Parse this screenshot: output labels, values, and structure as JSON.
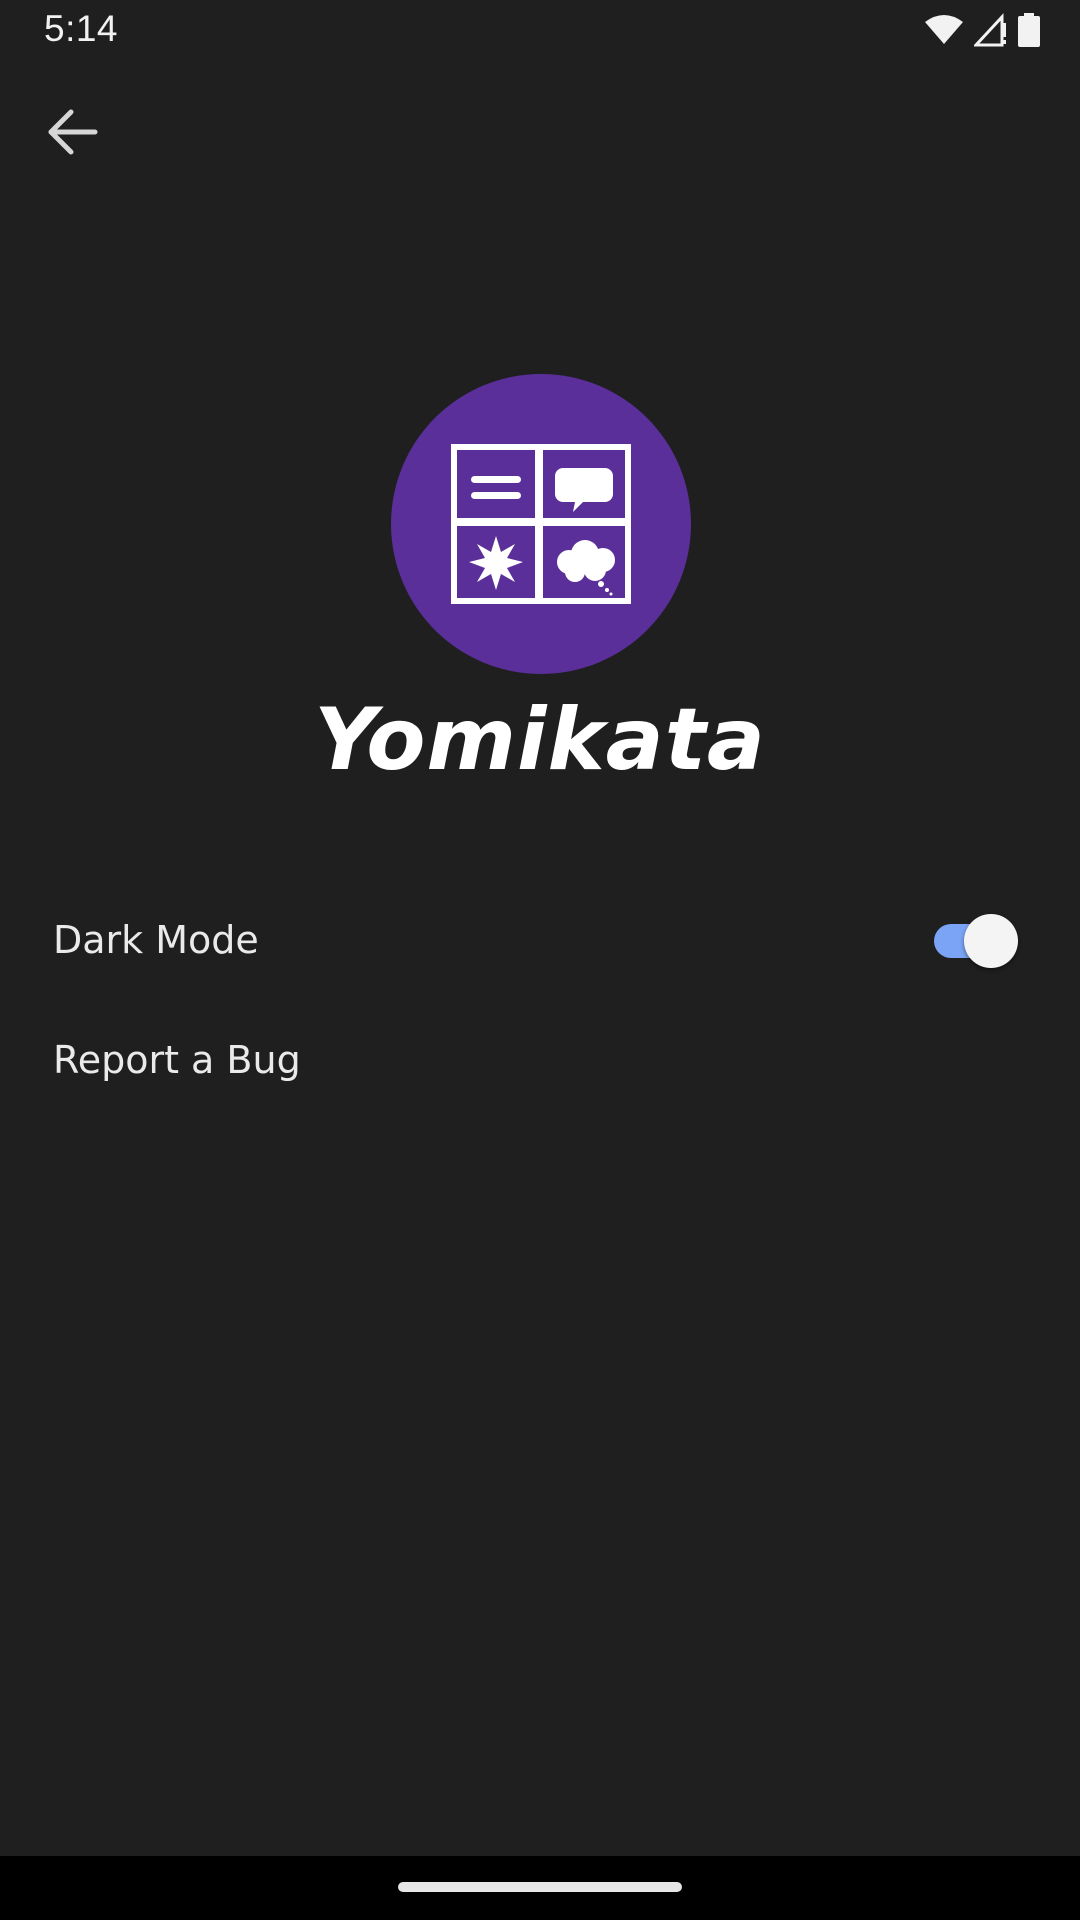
{
  "status_bar": {
    "time": "5:14",
    "icons": [
      "wifi-icon",
      "cell-signal-icon",
      "battery-icon"
    ]
  },
  "header": {
    "back_icon": "arrow-back-icon"
  },
  "logo": {
    "icon": "comic-panels-icon",
    "circle_color": "#5b2f9a",
    "app_name": "Yomikata"
  },
  "settings": {
    "dark_mode": {
      "label": "Dark Mode",
      "enabled": true,
      "accent_color": "#7ba4f6"
    },
    "report_bug": {
      "label": "Report a Bug"
    }
  }
}
